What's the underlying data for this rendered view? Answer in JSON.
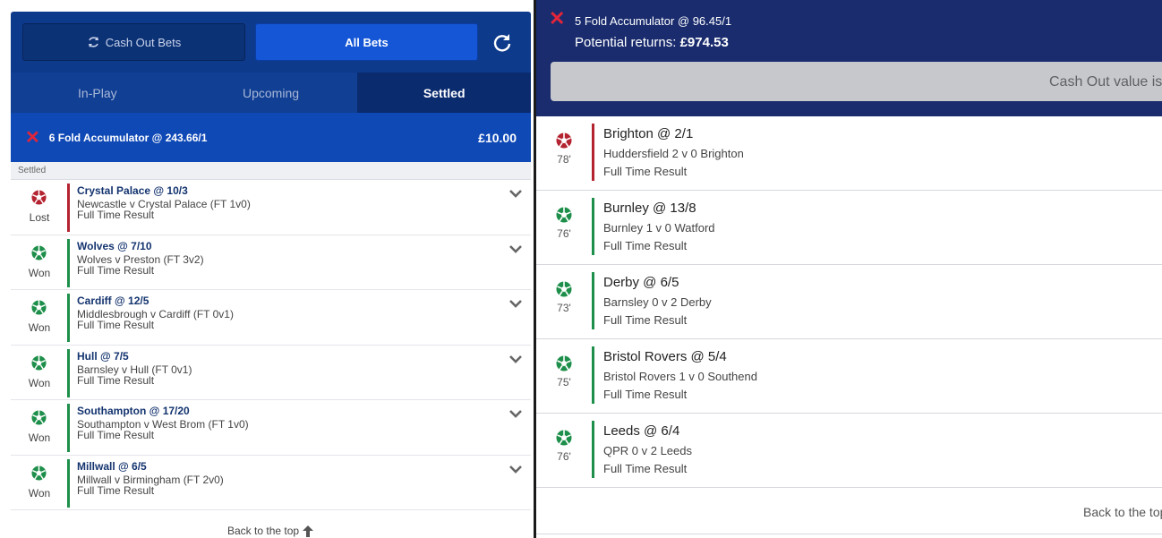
{
  "left": {
    "buttons": {
      "cash_out": "Cash Out Bets",
      "all_bets": "All Bets"
    },
    "tabs": [
      {
        "label": "In-Play",
        "active": false
      },
      {
        "label": "Upcoming",
        "active": false
      },
      {
        "label": "Settled",
        "active": true
      }
    ],
    "bet": {
      "title": "6 Fold Accumulator @ 243.66/1",
      "stake": "£10.00",
      "section": "Settled"
    },
    "legs": [
      {
        "selection": "Crystal Palace @ 10/3",
        "match": "Newcastle v Crystal Palace (FT 1v0)",
        "market": "Full Time Result",
        "result": "Lost"
      },
      {
        "selection": "Wolves @ 7/10",
        "match": "Wolves v Preston (FT 3v2)",
        "market": "Full Time Result",
        "result": "Won"
      },
      {
        "selection": "Cardiff @ 12/5",
        "match": "Middlesbrough v Cardiff (FT 0v1)",
        "market": "Full Time Result",
        "result": "Won"
      },
      {
        "selection": "Hull @ 7/5",
        "match": "Barnsley v Hull (FT 0v1)",
        "market": "Full Time Result",
        "result": "Won"
      },
      {
        "selection": "Southampton @ 17/20",
        "match": "Southampton v West Brom (FT 1v0)",
        "market": "Full Time Result",
        "result": "Won"
      },
      {
        "selection": "Millwall @ 6/5",
        "match": "Millwall v Birmingham (FT 2v0)",
        "market": "Full Time Result",
        "result": "Won"
      }
    ],
    "back_to_top": "Back to the top"
  },
  "right": {
    "bet": {
      "title": "5 Fold Accumulator @ 96.45/1",
      "returns_label": "Potential returns:",
      "returns_value": "£974.53",
      "cash_out_text": "Cash Out value is"
    },
    "legs": [
      {
        "selection": "Brighton @ 2/1",
        "match": "Huddersfield 2 v 0 Brighton",
        "market": "Full Time Result",
        "minute": "78'",
        "status": "losing"
      },
      {
        "selection": "Burnley @ 13/8",
        "match": "Burnley 1 v 0 Watford",
        "market": "Full Time Result",
        "minute": "76'",
        "status": "winning"
      },
      {
        "selection": "Derby @ 6/5",
        "match": "Barnsley 0 v 2 Derby",
        "market": "Full Time Result",
        "minute": "73'",
        "status": "winning"
      },
      {
        "selection": "Bristol Rovers @ 5/4",
        "match": "Bristol Rovers 1 v 0 Southend",
        "market": "Full Time Result",
        "minute": "75'",
        "status": "winning"
      },
      {
        "selection": "Leeds @ 6/4",
        "match": "QPR 0 v 2 Leeds",
        "market": "Full Time Result",
        "minute": "76'",
        "status": "winning"
      }
    ],
    "back_to_top": "Back to the top"
  },
  "colors": {
    "won": "#1d8f4a",
    "lost": "#b42330",
    "brand_dark": "#0e3a8c",
    "brand_bright": "#1456d6",
    "header_right": "#1a2c6e"
  },
  "icons": {
    "status": "football-icon",
    "expand": "chevron-down-icon",
    "refresh": "refresh-icon",
    "cash_out": "cash-out-icon",
    "settled": "close-icon",
    "back_to_top": "arrow-up-icon"
  }
}
